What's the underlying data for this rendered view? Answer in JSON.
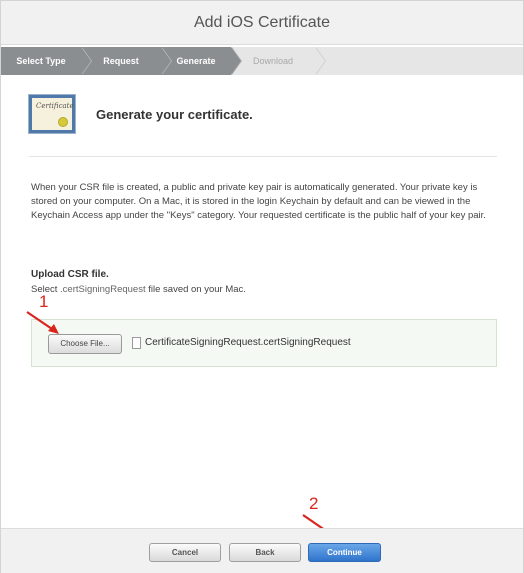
{
  "window": {
    "title": "Add iOS Certificate"
  },
  "steps": [
    {
      "label": "Select Type",
      "state": "done"
    },
    {
      "label": "Request",
      "state": "done"
    },
    {
      "label": "Generate",
      "state": "done"
    },
    {
      "label": "Download",
      "state": "todo"
    }
  ],
  "header": {
    "heading": "Generate your certificate.",
    "icon_text": "Certificate"
  },
  "body": {
    "paragraph": "When your CSR file is created, a public and private key pair is automatically generated. Your private key is stored on your computer. On a Mac, it is stored in the login Keychain by default and can be viewed in the Keychain Access app under the \"Keys\" category. Your requested certificate is the public half of your key pair."
  },
  "upload": {
    "title": "Upload CSR file.",
    "desc_prefix": "Select ",
    "desc_ext": ".certSigningRequest",
    "desc_suffix": " file saved on your Mac.",
    "choose_label": "Choose File...",
    "file_name": "CertificateSigningRequest.certSigningRequest"
  },
  "annotations": {
    "first": "1",
    "second": "2"
  },
  "footer": {
    "cancel_label": "Cancel",
    "back_label": "Back",
    "continue_label": "Continue"
  },
  "colors": {
    "accent_blue": "#2f74cc",
    "step_done": "#8a8e90",
    "annotation_red": "#d9251c",
    "upload_bg": "#f5f9f3"
  }
}
